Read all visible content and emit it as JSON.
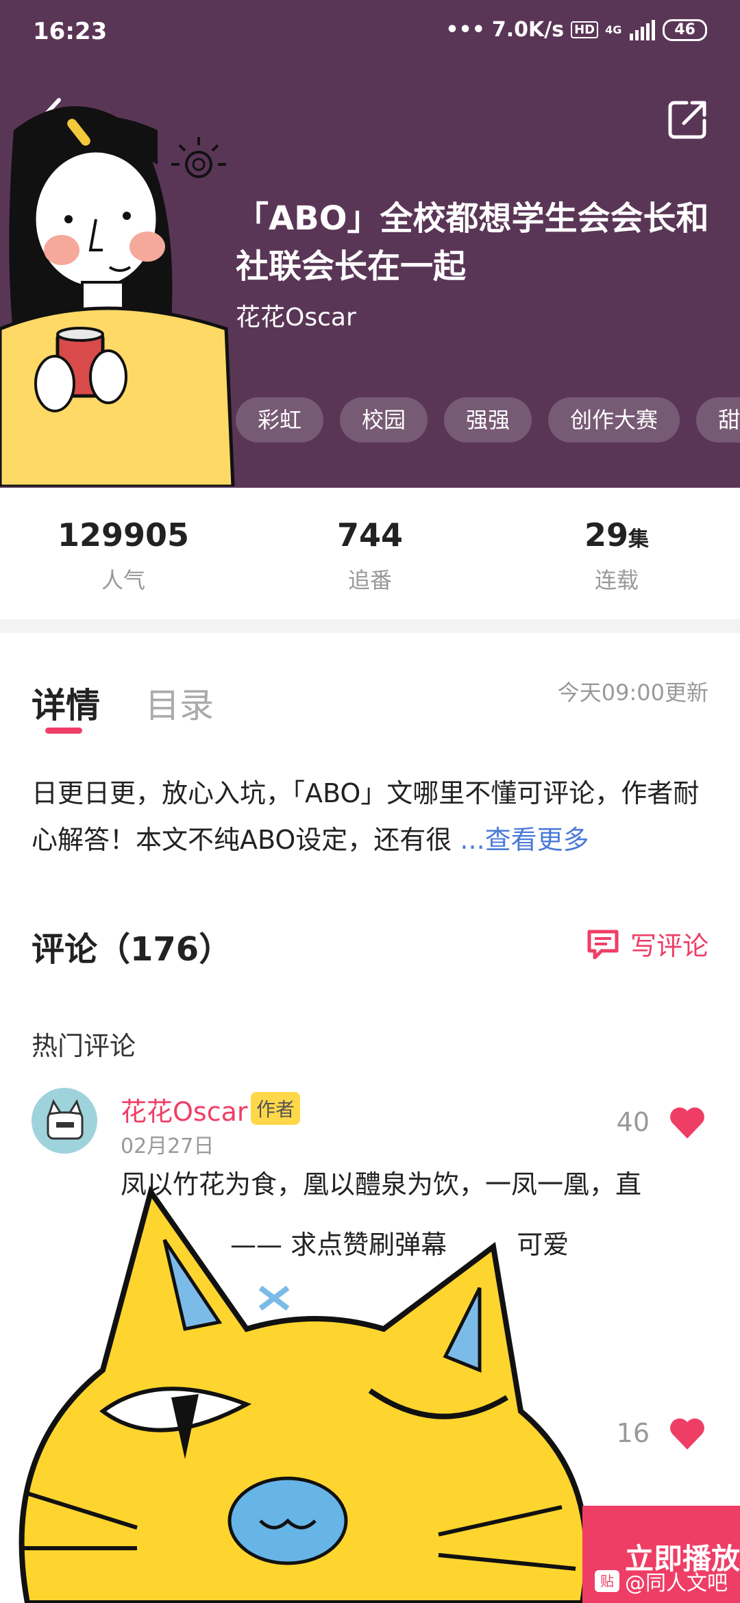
{
  "status_bar": {
    "time": "16:23",
    "network_speed": "7.0K/s",
    "hd_label": "HD",
    "network_type": "4G",
    "battery": "46"
  },
  "work": {
    "title": "「ABO」全校都想学生会会长和社联会长在一起",
    "author": "花花Oscar",
    "tags": [
      "彩虹",
      "校园",
      "强强",
      "创作大赛",
      "甜"
    ]
  },
  "stats": [
    {
      "value": "129905",
      "unit": "",
      "label": "人气"
    },
    {
      "value": "744",
      "unit": "",
      "label": "追番"
    },
    {
      "value": "29",
      "unit": "集",
      "label": "连载"
    }
  ],
  "tabs": {
    "details": "详情",
    "toc": "目录",
    "update_time": "今天09:00更新"
  },
  "description": {
    "text": "日更日更，放心入坑，「ABO」文哪里不懂可评论，作者耐心解答！本文不纯ABO设定，还有很",
    "more": "...查看更多"
  },
  "comments": {
    "title": "评论（176）",
    "write_label": "写评论",
    "hot_label": "热门评论",
    "items": [
      {
        "name": "花花Oscar",
        "badge": "作者",
        "date": "02月27日",
        "likes": "40",
        "text_line1": "凤以竹花为食，凰以醴泉为饮，一凤一凰，直",
        "text_line2": "—— 求点赞刷弹幕",
        "text_line2_end": "可爱"
      },
      {
        "likes": "16"
      }
    ]
  },
  "play_button": "立即播放",
  "watermark": "@同人文吧",
  "colors": {
    "header_bg": "#5a3656",
    "accent": "#ef3e66",
    "link": "#4a7bd8"
  }
}
